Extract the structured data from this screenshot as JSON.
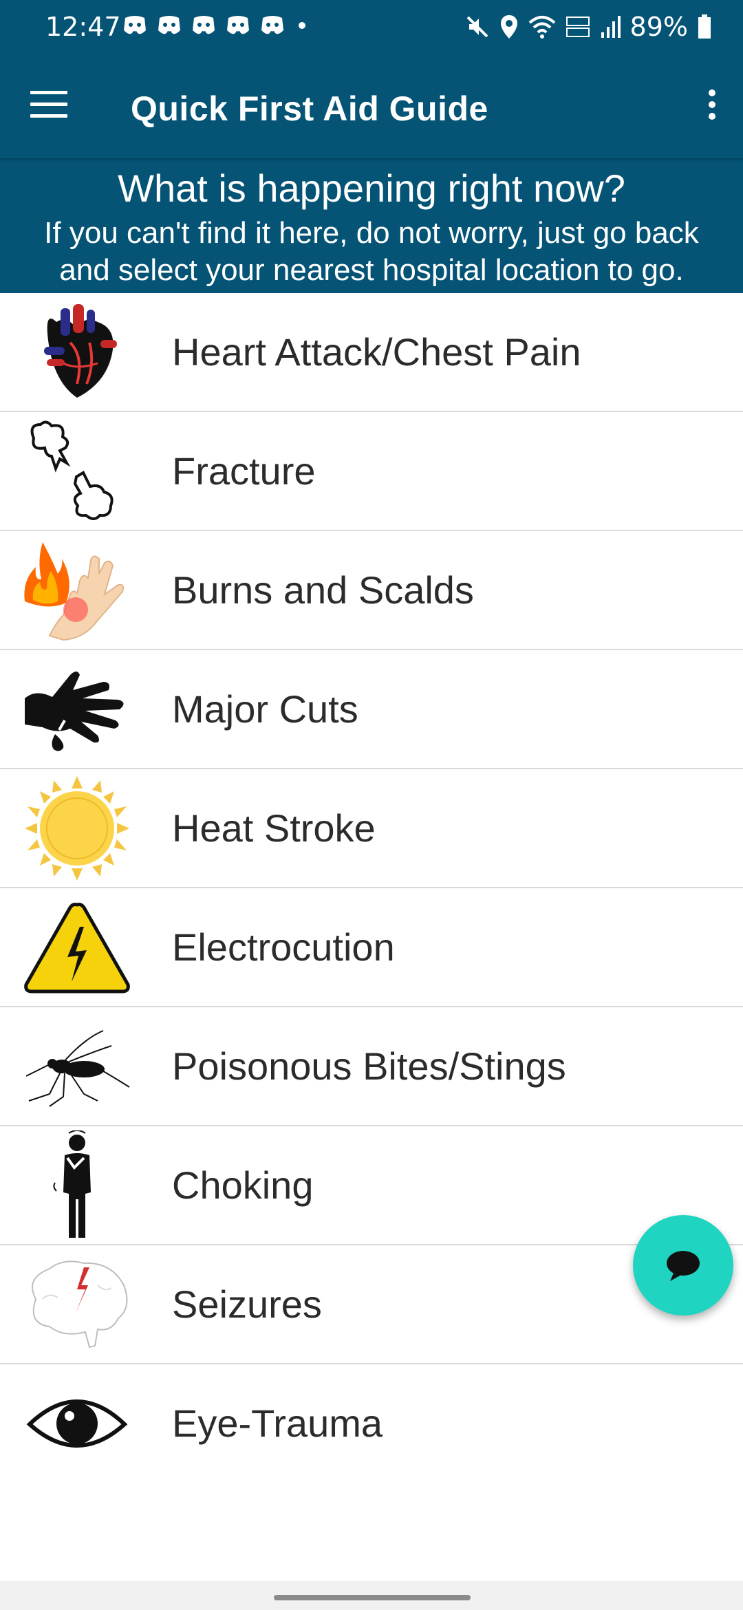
{
  "status_bar": {
    "time": "12:47",
    "battery": "89%"
  },
  "app_bar": {
    "title": "Quick First Aid Guide"
  },
  "banner": {
    "question": "What is happening right now?",
    "subtitle": "If you can't find it here, do not worry, just go back and select your nearest hospital location to go."
  },
  "items": [
    {
      "label": "Heart Attack/Chest Pain",
      "icon": "heart-icon"
    },
    {
      "label": "Fracture",
      "icon": "bone-icon"
    },
    {
      "label": "Burns and Scalds",
      "icon": "burn-hand-icon"
    },
    {
      "label": "Major Cuts",
      "icon": "cut-hand-icon"
    },
    {
      "label": "Heat Stroke",
      "icon": "sun-icon"
    },
    {
      "label": "Electrocution",
      "icon": "high-voltage-icon"
    },
    {
      "label": "Poisonous Bites/Stings",
      "icon": "mosquito-icon"
    },
    {
      "label": "Choking",
      "icon": "choking-person-icon"
    },
    {
      "label": "Seizures",
      "icon": "brain-icon"
    },
    {
      "label": "Eye-Trauma",
      "icon": "eye-icon"
    }
  ],
  "colors": {
    "primary": "#055476",
    "fab": "#1fd5c2",
    "divider": "#d9d9d9"
  }
}
